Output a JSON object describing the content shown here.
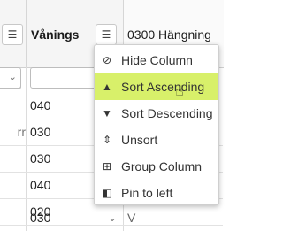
{
  "header": {
    "col_b_title": "Vånings",
    "col_c_title": "0300 Hängning",
    "menu_icon": "menu-lines-icon"
  },
  "rows": [
    {
      "a": "",
      "b": "040",
      "c": ""
    },
    {
      "a": "rr",
      "b": "030",
      "c": ""
    },
    {
      "a": "",
      "b": "030",
      "c": ""
    },
    {
      "a": "",
      "b": "040",
      "c": ""
    },
    {
      "a": "",
      "b": "020",
      "c": ""
    },
    {
      "a": "",
      "b": "030",
      "c": "V"
    }
  ],
  "column_menu": {
    "items": [
      {
        "label": "Hide Column",
        "icon": "eye-slash-icon"
      },
      {
        "label": "Sort Ascending",
        "icon": "sort-asc-icon"
      },
      {
        "label": "Sort Descending",
        "icon": "sort-desc-icon"
      },
      {
        "label": "Unsort",
        "icon": "unsort-icon"
      },
      {
        "label": "Group Column",
        "icon": "group-icon"
      },
      {
        "label": "Pin to left",
        "icon": "pin-left-icon"
      }
    ],
    "highlighted_item": "Sort Ascending",
    "highlight_color": "#d8f06a"
  }
}
